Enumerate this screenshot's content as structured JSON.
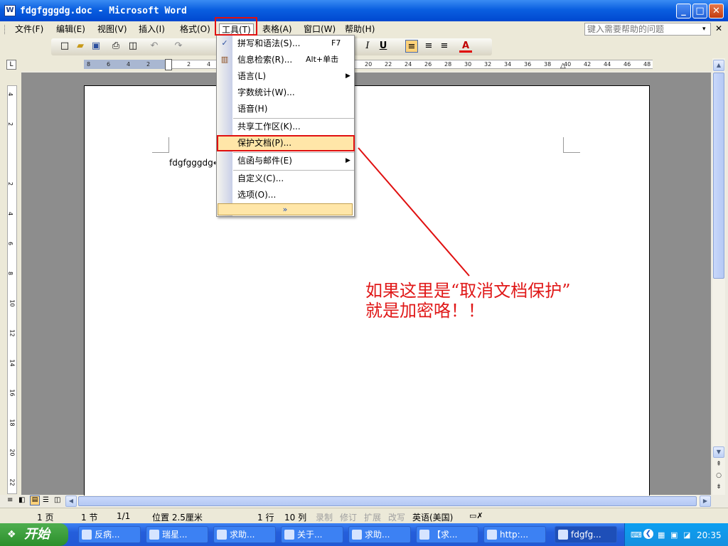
{
  "window": {
    "title": "fdgfgggdg.doc - Microsoft Word",
    "app_icon": "W",
    "minimize": "_",
    "maximize": "□",
    "close": "✕"
  },
  "menubar": {
    "items": [
      {
        "label": "文件(F)"
      },
      {
        "label": "编辑(E)"
      },
      {
        "label": "视图(V)"
      },
      {
        "label": "插入(I)"
      },
      {
        "label": "格式(O)"
      },
      {
        "label": "工具(T)"
      },
      {
        "label": "表格(A)"
      },
      {
        "label": "窗口(W)"
      },
      {
        "label": "帮助(H)"
      }
    ],
    "help_placeholder": "键入需要帮助的问题",
    "help_arrow": "▾",
    "close_doc": "✕"
  },
  "toolbar": {
    "icons": [
      "new-document-icon",
      "open-folder-icon",
      "save-icon",
      "print-icon",
      "print-preview-icon",
      "undo-icon",
      "redo-icon",
      "italic-icon",
      "underline-icon",
      "align-left-icon",
      "align-center-icon",
      "align-right-icon",
      "font-color-icon"
    ],
    "italic": "I",
    "underline": "U",
    "font_color": "A"
  },
  "tools_menu": {
    "items": [
      {
        "label": "拼写和语法(S)...",
        "shortcut": "F7",
        "submenu": false
      },
      {
        "label": "信息检索(R)...",
        "shortcut": "Alt+单击",
        "submenu": false
      },
      {
        "label": "语言(L)",
        "shortcut": "",
        "submenu": true
      },
      {
        "label": "字数统计(W)...",
        "shortcut": "",
        "submenu": false
      },
      {
        "label": "语音(H)",
        "shortcut": "",
        "submenu": false
      },
      {
        "label": "共享工作区(K)...",
        "shortcut": "",
        "submenu": false
      },
      {
        "label": "保护文档(P)...",
        "shortcut": "",
        "submenu": false,
        "highlighted": true
      },
      {
        "label": "信函与邮件(E)",
        "shortcut": "",
        "submenu": true
      },
      {
        "label": "自定义(C)...",
        "shortcut": "",
        "submenu": false
      },
      {
        "label": "选项(O)...",
        "shortcut": "",
        "submenu": false
      }
    ],
    "expand": "»"
  },
  "ruler": {
    "ticks": [
      "8",
      "6",
      "4",
      "2",
      "",
      "2",
      "4",
      "20",
      "22",
      "24",
      "26",
      "28",
      "30",
      "32",
      "34",
      "36",
      "38",
      "40",
      "42",
      "44",
      "46",
      "48"
    ],
    "vticks": [
      "4",
      "2",
      "",
      "2",
      "4",
      "6",
      "8",
      "10",
      "12",
      "14",
      "16",
      "18",
      "20",
      "22"
    ]
  },
  "document": {
    "text": "fdgfgggdg↵"
  },
  "annotation": {
    "line1": "如果这里是“取消文档保护”",
    "line2": "就是加密咯！！"
  },
  "statusbar": {
    "page": "1 页",
    "section": "1 节",
    "page_of": "1/1",
    "position": "位置 2.5厘米",
    "line": "1 行",
    "column": "10 列",
    "rec": "录制",
    "trk": "修订",
    "ext": "扩展",
    "ovr": "改写",
    "language": "英语(美国)"
  },
  "taskbar": {
    "start": "开始",
    "tasks": [
      {
        "label": "反病..."
      },
      {
        "label": "瑞星..."
      },
      {
        "label": "求助..."
      },
      {
        "label": "关于..."
      },
      {
        "label": "求助..."
      },
      {
        "label": "【求..."
      },
      {
        "label": "http:..."
      },
      {
        "label": "fdgfg...",
        "active": true
      }
    ],
    "clock": "20:35"
  },
  "colors": {
    "annotation_red": "#e01010",
    "title_blue": "#0a5fe0",
    "menu_highlight": "#ffe6a8"
  }
}
